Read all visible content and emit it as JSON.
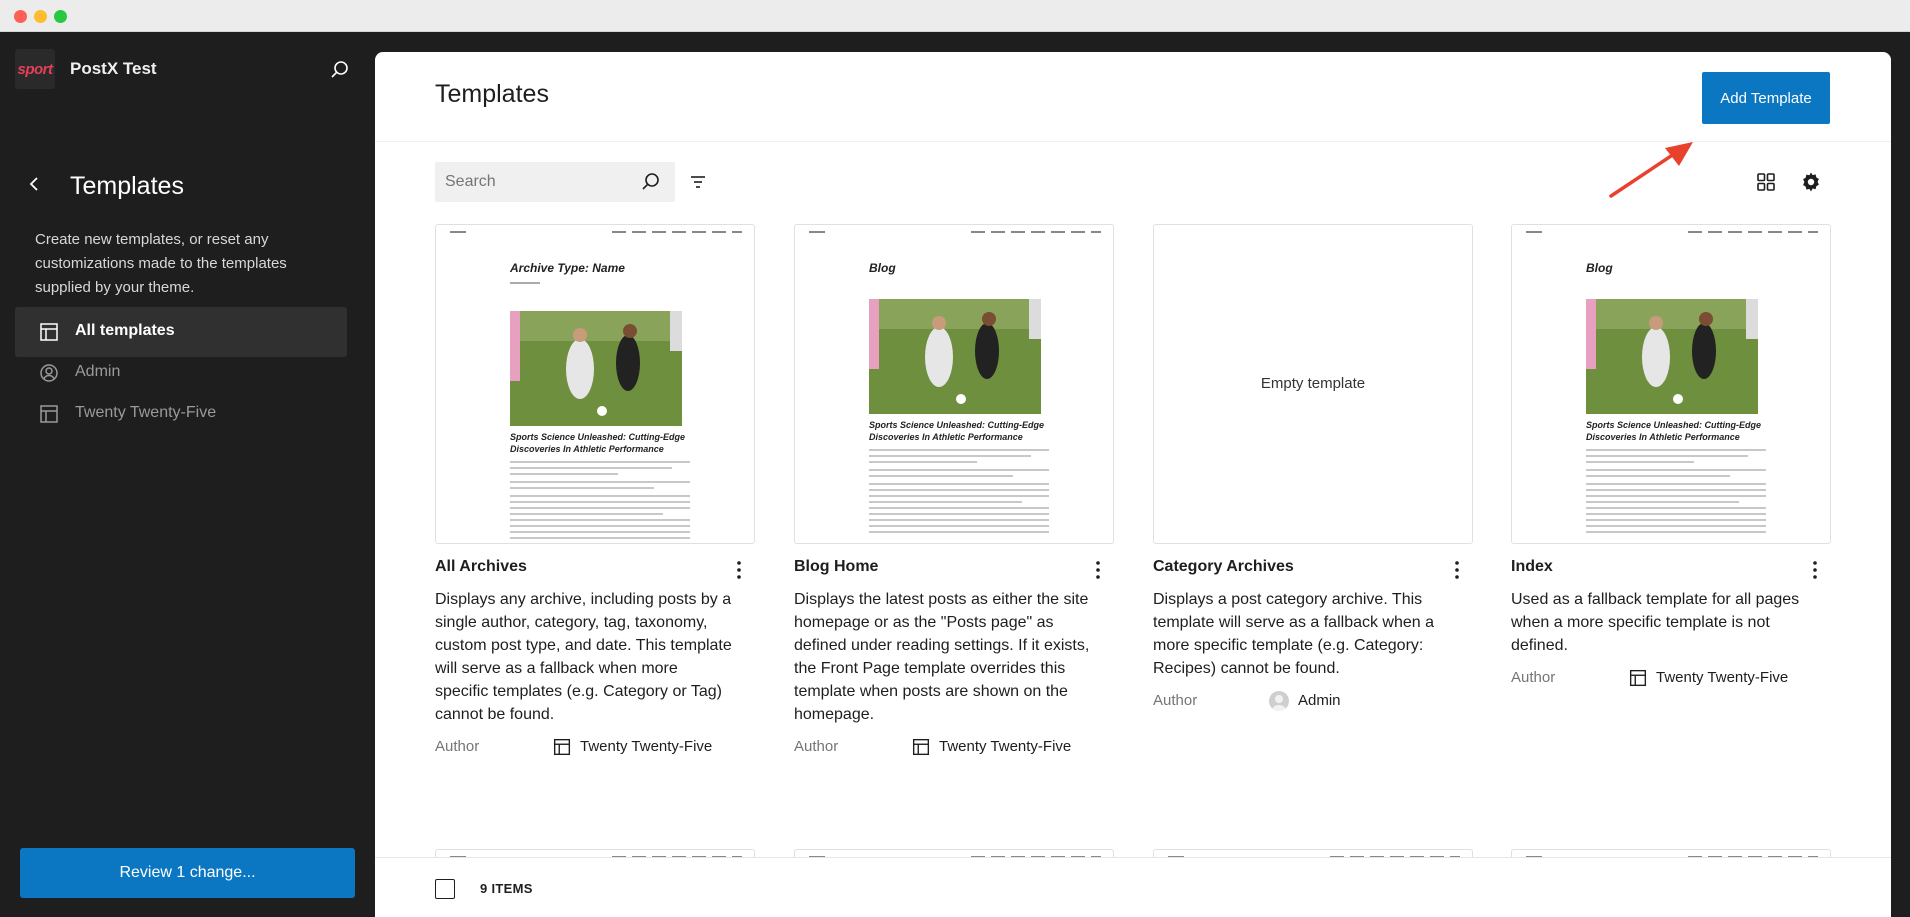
{
  "window": {
    "title": ""
  },
  "sidebar": {
    "site_title": "PostX Test",
    "logo_text": "sport",
    "heading": "Templates",
    "description": "Create new templates, or reset any customizations made to the templates supplied by your theme.",
    "items": [
      {
        "label": "All templates",
        "icon": "layout-icon",
        "active": true
      },
      {
        "label": "Admin",
        "icon": "user-circle-icon",
        "active": false
      },
      {
        "label": "Twenty Twenty-Five",
        "icon": "layout-icon",
        "active": false
      }
    ],
    "review_label": "Review 1 change..."
  },
  "main": {
    "title": "Templates",
    "add_label": "Add Template",
    "search_placeholder": "Search",
    "cards": [
      {
        "name": "All Archives",
        "preview_heading": "Archive Type: Name",
        "post_title": "Sports Science Unleashed: Cutting-Edge Discoveries In Athletic Performance",
        "description": "Displays any archive, including posts by a single author, category, tag, taxonomy, custom post type, and date. This template will serve as a fallback when more specific templates (e.g. Category or Tag) cannot be found.",
        "meta_label": "Author",
        "meta_value": "Twenty Twenty-Five"
      },
      {
        "name": "Blog Home",
        "preview_heading": "Blog",
        "post_title": "Sports Science Unleashed: Cutting-Edge Discoveries In Athletic Performance",
        "description": "Displays the latest posts as either the site homepage or as the \"Posts page\" as defined under reading settings. If it exists, the Front Page template overrides this template when posts are shown on the homepage.",
        "meta_label": "Author",
        "meta_value": "Twenty Twenty-Five"
      },
      {
        "name": "Category Archives",
        "empty_text": "Empty template",
        "description": "Displays a post category archive. This template will serve as a fallback when a more specific template (e.g. Category: Recipes) cannot be found.",
        "meta_label": "Author",
        "meta_value": "Admin"
      },
      {
        "name": "Index",
        "preview_heading": "Blog",
        "post_title": "Sports Science Unleashed: Cutting-Edge Discoveries In Athletic Performance",
        "description": "Used as a fallback template for all pages when a more specific template is not defined.",
        "meta_label": "Author",
        "meta_value": "Twenty Twenty-Five"
      }
    ],
    "footer": {
      "count_label": "9 ITEMS"
    }
  },
  "colors": {
    "accent": "#0b77c2",
    "sidebar_bg": "#1e1e1e",
    "arrow": "#e8412c"
  }
}
